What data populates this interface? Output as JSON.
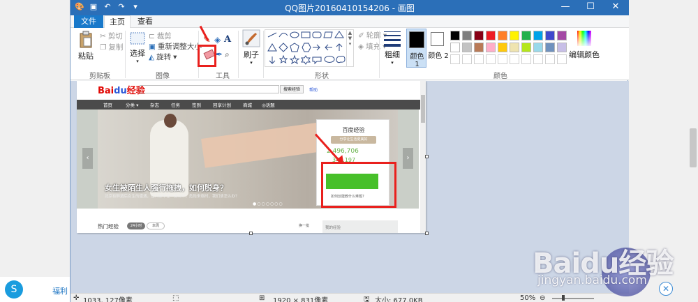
{
  "window": {
    "title": "QQ图片20160410154206 - 画图",
    "minimize": "—",
    "maximize": "☐",
    "close": "✕"
  },
  "tabs": [
    "文件",
    "主页",
    "查看"
  ],
  "ribbon": {
    "clipboard": {
      "paste": "粘贴",
      "cut": "剪切",
      "copy": "复制",
      "label": "剪贴板"
    },
    "image": {
      "select": "选择",
      "crop": "裁剪",
      "resize": "重新调整大小",
      "rotate": "旋转",
      "label": "图像"
    },
    "tools": {
      "label": "工具"
    },
    "brushes": "刷子",
    "shapes": {
      "outline": "轮廓",
      "fill": "填充",
      "label": "形状"
    },
    "size": "粗细",
    "color1": "颜色 1",
    "color2": "颜色 2",
    "edit_colors": "编辑颜色",
    "colors_label": "颜色"
  },
  "palette": {
    "row1": [
      "#000000",
      "#7f7f7f",
      "#880015",
      "#ed1c24",
      "#ff7f27",
      "#fff200",
      "#22b14c",
      "#00a2e8",
      "#3f48cc",
      "#a349a4"
    ],
    "row2": [
      "#ffffff",
      "#c3c3c3",
      "#b97a57",
      "#ffaec9",
      "#ffc90e",
      "#efe4b0",
      "#b5e61d",
      "#99d9ea",
      "#7092be",
      "#c8bfe7"
    ]
  },
  "colors": {
    "color1": "#000000",
    "color2": "#ffffff",
    "highlight": "#e9201d",
    "titlebar": "#2b6fb8"
  },
  "statusbar": {
    "cursor": "1033, 127像素",
    "dimensions": "1920 × 831像素",
    "filesize": "大小: 677.0KB",
    "zoom": "50%"
  },
  "picture": {
    "logo_red": "Bai",
    "logo_blue": "du",
    "logo_suffix": "经验",
    "search_button": "搜索经验",
    "help": "帮助",
    "nav": [
      "首页",
      "分类 ▾",
      "杂志",
      "任务",
      "签到",
      "回享计划",
      "商城",
      "◎话题"
    ],
    "headline": "女生被陌生人强行拖拽，如何脱身？",
    "subheadline": "北京有醉酒后女生的遭遇，让人禁不住一身冷汗，危险来临时，我们该怎么办？",
    "card_title": "百度经验",
    "card_banner": "分享让生活更美好",
    "card_count1": "2,496,706",
    "card_count2": "340,197",
    "card_link": "如何创建教什么难题?",
    "hot": "热门经验",
    "pill1": "24小时",
    "pill2": "本周",
    "batch": "换一批",
    "my_exp": "我的经验"
  },
  "desktop": {
    "fuli": "福利",
    "watermark": "Baidu经验",
    "watermark_url": "jingyan.baidu.com",
    "close_symbol": "✕"
  }
}
